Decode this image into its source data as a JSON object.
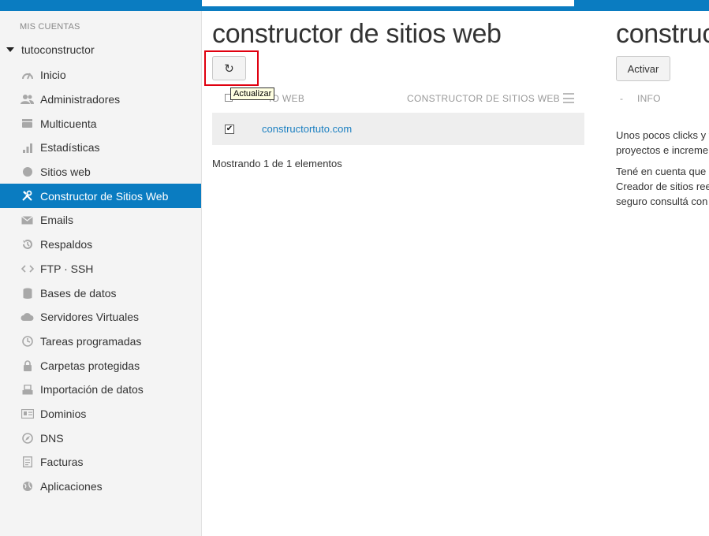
{
  "sidebar": {
    "heading": "MIS CUENTAS",
    "account": "tutoconstructor",
    "items": [
      {
        "label": "Inicio",
        "icon": "gauge-icon"
      },
      {
        "label": "Administradores",
        "icon": "users-icon"
      },
      {
        "label": "Multicuenta",
        "icon": "stack-icon"
      },
      {
        "label": "Estadísticas",
        "icon": "bar-chart-icon"
      },
      {
        "label": "Sitios web",
        "icon": "globe-icon"
      },
      {
        "label": "Constructor de Sitios Web",
        "icon": "tools-icon",
        "active": true
      },
      {
        "label": "Emails",
        "icon": "envelope-icon"
      },
      {
        "label": "Respaldos",
        "icon": "history-icon"
      },
      {
        "label": "FTP · SSH",
        "icon": "code-icon"
      },
      {
        "label": "Bases de datos",
        "icon": "database-icon"
      },
      {
        "label": "Servidores Virtuales",
        "icon": "cloud-icon"
      },
      {
        "label": "Tareas programadas",
        "icon": "clock-icon"
      },
      {
        "label": "Carpetas protegidas",
        "icon": "lock-icon"
      },
      {
        "label": "Importación de datos",
        "icon": "import-icon"
      },
      {
        "label": "Dominios",
        "icon": "id-card-icon"
      },
      {
        "label": "DNS",
        "icon": "compass-icon"
      },
      {
        "label": "Facturas",
        "icon": "document-icon"
      },
      {
        "label": "Aplicaciones",
        "icon": "apps-globe-icon"
      }
    ]
  },
  "main": {
    "title": "constructor de sitios web",
    "refresh_glyph": "↻",
    "tooltip": "Actualizar",
    "columns": {
      "left_visible": "IO WEB",
      "right": "CONSTRUCTOR DE SITIOS WEB"
    },
    "rows": [
      {
        "checked": "✔",
        "domain": "constructortuto.com"
      }
    ],
    "showing": "Mostrando 1 de 1 elementos"
  },
  "panel": {
    "title": "construc",
    "activate_label": "Activar",
    "tab_sep": "-",
    "tab_info": "INFO",
    "text_lines": [
      "Unos pocos clicks y t",
      "proyectos e increme",
      "Tené en cuenta que",
      "Creador de sitios ree",
      "seguro consultá con"
    ]
  }
}
